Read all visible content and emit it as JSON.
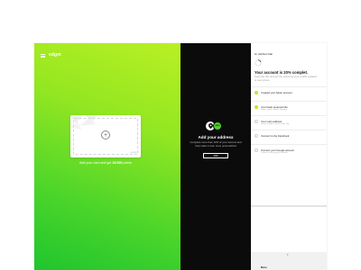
{
  "app": {
    "brand": "edgm"
  },
  "card": {
    "brand": "edgm",
    "caption_prefix": "Add your card and get ",
    "caption_points": "15.000",
    "caption_suffix": " points"
  },
  "address": {
    "badge": "5000",
    "title": "Add your address",
    "description": "Complete more than 10% of your account and help make it even more personalized",
    "button": "ADD"
  },
  "profile": {
    "greeting": "Hi, Edibed Nab",
    "progress_title": "Your account is 20% complet.",
    "progress_value": 0.2,
    "progress_description": "Keep the this and get the points for your profile updated to new prices."
  },
  "tasks": [
    {
      "title": "Created your Adam account",
      "subtitle": "",
      "done": true
    },
    {
      "title": "Your basic personal info",
      "subtitle": "Name, email, mobile, birthday",
      "done": true
    },
    {
      "title": "Your main address",
      "subtitle": "Street, number, postal code, city",
      "done": false
    },
    {
      "title": "Connect to the Facebook",
      "subtitle": "",
      "done": false
    },
    {
      "title": "Connect your Google account",
      "subtitle": "Connect to keep your calendar",
      "done": false
    }
  ],
  "more": {
    "label": "More"
  },
  "colors": {
    "accent": "#b6ee22",
    "dark": "#0b0b0b",
    "green": "#4fd02a"
  }
}
